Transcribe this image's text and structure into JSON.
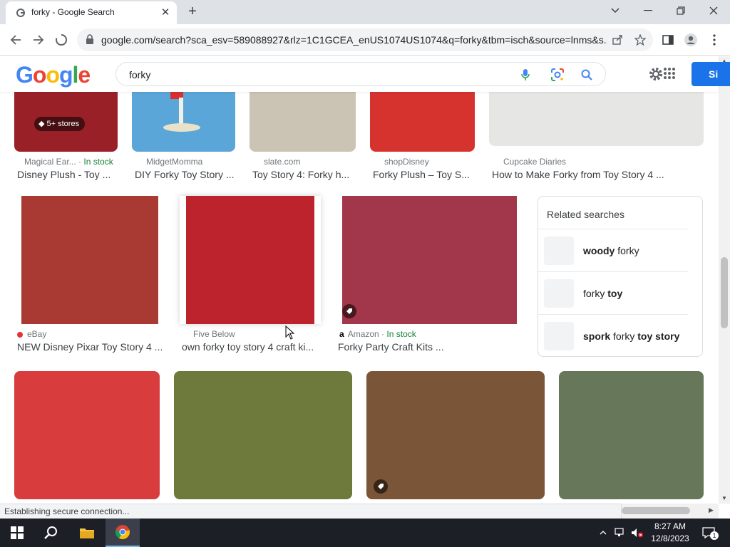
{
  "browser": {
    "tab_title": "forky - Google Search",
    "url": "google.com/search?sca_esv=589088927&rlz=1C1GCEA_enUS1074US1074&q=forky&tbm=isch&source=lnms&s..."
  },
  "google": {
    "logo": "Google",
    "query": "forky",
    "signin_label": "Si"
  },
  "results": {
    "row1": [
      {
        "color": "#9a2028",
        "badge": "5+ stores",
        "source": "Magical Ear...",
        "stock": "In stock",
        "title": "Disney Plush - Toy ..."
      },
      {
        "color": "#5aa6d8",
        "source": "MidgetMomma",
        "title": "DIY Forky Toy Story ..."
      },
      {
        "color": "#cbc3b4",
        "source": "slate.com",
        "title": "Toy Story 4: Forky h..."
      },
      {
        "color": "#d6332e",
        "source": "shopDisney",
        "title": "Forky Plush – Toy S..."
      },
      {
        "color": "#e6e7e5",
        "source": "Cupcake Diaries",
        "title": "How to Make Forky from Toy Story 4 ..."
      }
    ],
    "row2": [
      {
        "color": "#a93a33",
        "source": "eBay",
        "title": "NEW Disney Pixar Toy Story 4 ..."
      },
      {
        "color": "#bd232d",
        "source": "Five Below",
        "title": "own forky toy story 4 craft ki..."
      },
      {
        "color": "#a2364b",
        "source": "Amazon",
        "stock": "In stock",
        "title": "Forky Party Craft Kits ..."
      }
    ],
    "row3": [
      {
        "color": "#d83c3c"
      },
      {
        "color": "#6e7a3c"
      },
      {
        "color": "#7a5537"
      },
      {
        "color": "#677759"
      }
    ],
    "separator": " · "
  },
  "related": {
    "heading": "Related searches",
    "items": [
      {
        "parts": [
          {
            "t": "woody",
            "b": true
          },
          {
            "t": " forky",
            "b": false
          }
        ]
      },
      {
        "parts": [
          {
            "t": "forky ",
            "b": false
          },
          {
            "t": "toy",
            "b": true
          }
        ]
      },
      {
        "parts": [
          {
            "t": "spork",
            "b": true
          },
          {
            "t": " forky ",
            "b": false
          },
          {
            "t": "toy story",
            "b": true
          }
        ]
      }
    ]
  },
  "status": {
    "text": "Establishing secure connection..."
  },
  "taskbar": {
    "time": "8:27 AM",
    "date": "12/8/2023",
    "notification_count": "1"
  }
}
